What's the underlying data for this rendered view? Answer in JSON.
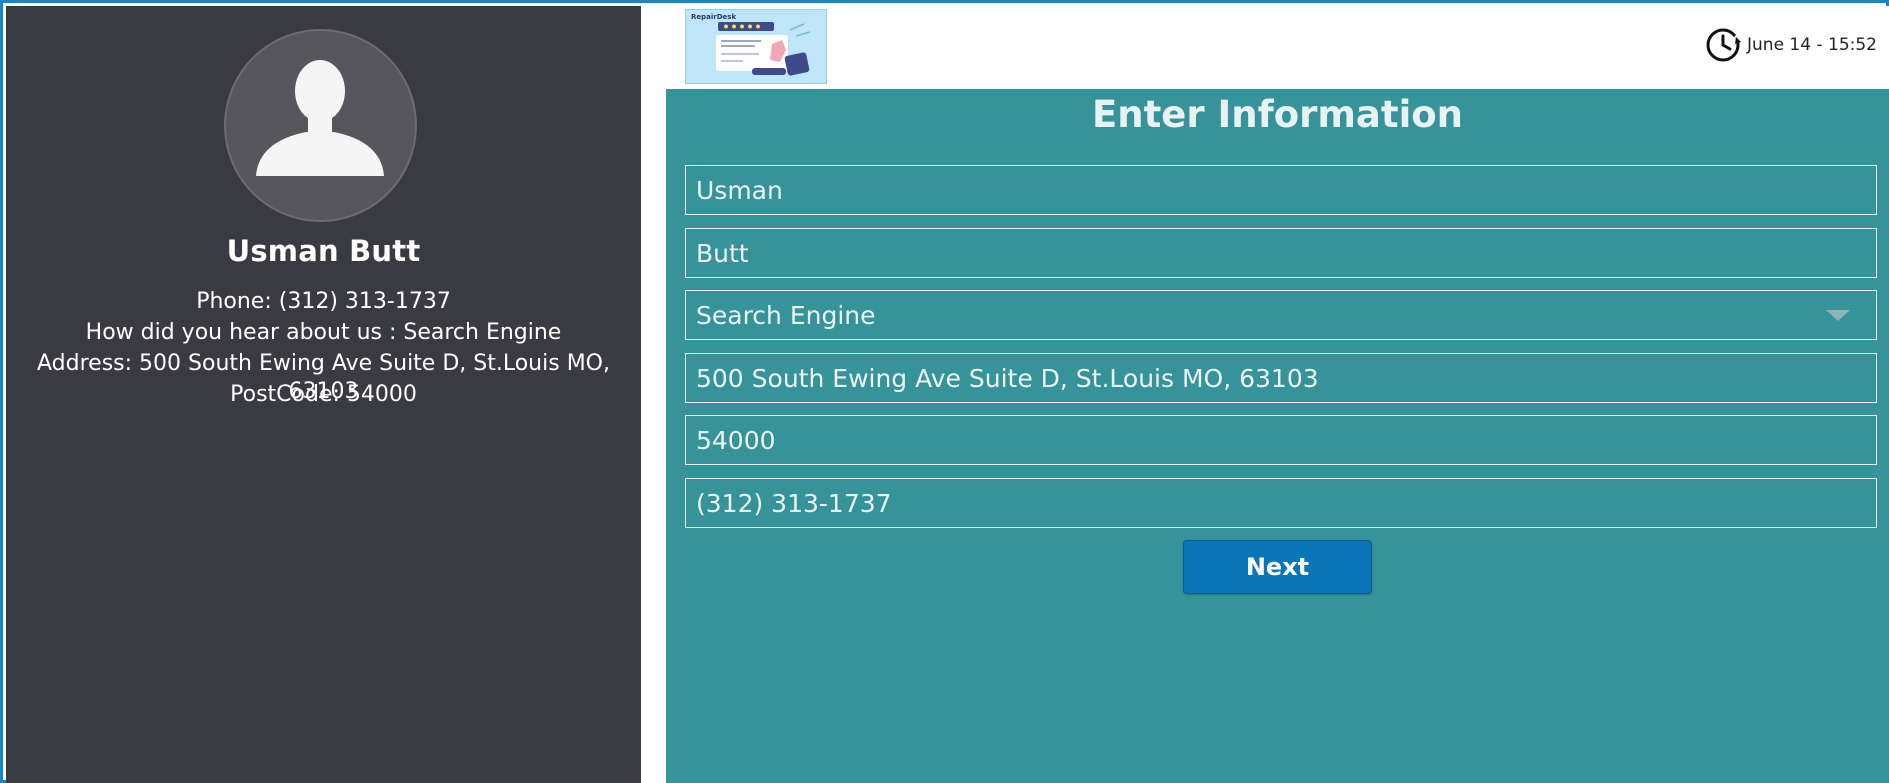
{
  "profile": {
    "name": "Usman Butt",
    "phone_line": "Phone: (312) 313-1737",
    "heard_line": "How did you hear about us : Search Engine",
    "address_line": "Address: 500 South Ewing Ave Suite D, St.Louis MO, 63103",
    "postcode_line": "PostCode: 54000"
  },
  "header": {
    "logo_brand": "RepairDesk",
    "datetime": "June 14 - 15:52",
    "clock_icon": "clock-history-icon"
  },
  "form": {
    "title": "Enter Information",
    "first_name": "Usman",
    "last_name": "Butt",
    "referral_source": "Search Engine",
    "address": "500 South Ewing Ave Suite D, St.Louis  MO, 63103",
    "postcode": "54000",
    "phone": "(312) 313-1737",
    "next_label": "Next"
  },
  "colors": {
    "left_panel": "#3a3a42",
    "main_panel": "#37939a",
    "accent_button": "#0a76b8",
    "frame_border": "#1a86c6"
  }
}
